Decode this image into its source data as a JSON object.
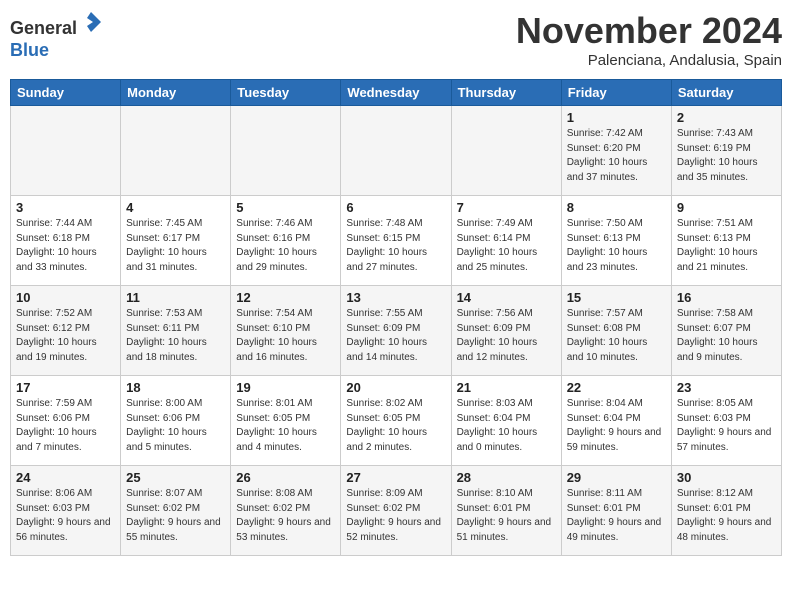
{
  "header": {
    "logo_line1": "General",
    "logo_line2": "Blue",
    "month": "November 2024",
    "location": "Palenciana, Andalusia, Spain"
  },
  "weekdays": [
    "Sunday",
    "Monday",
    "Tuesday",
    "Wednesday",
    "Thursday",
    "Friday",
    "Saturday"
  ],
  "weeks": [
    [
      {
        "day": "",
        "info": ""
      },
      {
        "day": "",
        "info": ""
      },
      {
        "day": "",
        "info": ""
      },
      {
        "day": "",
        "info": ""
      },
      {
        "day": "",
        "info": ""
      },
      {
        "day": "1",
        "info": "Sunrise: 7:42 AM\nSunset: 6:20 PM\nDaylight: 10 hours and 37 minutes."
      },
      {
        "day": "2",
        "info": "Sunrise: 7:43 AM\nSunset: 6:19 PM\nDaylight: 10 hours and 35 minutes."
      }
    ],
    [
      {
        "day": "3",
        "info": "Sunrise: 7:44 AM\nSunset: 6:18 PM\nDaylight: 10 hours and 33 minutes."
      },
      {
        "day": "4",
        "info": "Sunrise: 7:45 AM\nSunset: 6:17 PM\nDaylight: 10 hours and 31 minutes."
      },
      {
        "day": "5",
        "info": "Sunrise: 7:46 AM\nSunset: 6:16 PM\nDaylight: 10 hours and 29 minutes."
      },
      {
        "day": "6",
        "info": "Sunrise: 7:48 AM\nSunset: 6:15 PM\nDaylight: 10 hours and 27 minutes."
      },
      {
        "day": "7",
        "info": "Sunrise: 7:49 AM\nSunset: 6:14 PM\nDaylight: 10 hours and 25 minutes."
      },
      {
        "day": "8",
        "info": "Sunrise: 7:50 AM\nSunset: 6:13 PM\nDaylight: 10 hours and 23 minutes."
      },
      {
        "day": "9",
        "info": "Sunrise: 7:51 AM\nSunset: 6:13 PM\nDaylight: 10 hours and 21 minutes."
      }
    ],
    [
      {
        "day": "10",
        "info": "Sunrise: 7:52 AM\nSunset: 6:12 PM\nDaylight: 10 hours and 19 minutes."
      },
      {
        "day": "11",
        "info": "Sunrise: 7:53 AM\nSunset: 6:11 PM\nDaylight: 10 hours and 18 minutes."
      },
      {
        "day": "12",
        "info": "Sunrise: 7:54 AM\nSunset: 6:10 PM\nDaylight: 10 hours and 16 minutes."
      },
      {
        "day": "13",
        "info": "Sunrise: 7:55 AM\nSunset: 6:09 PM\nDaylight: 10 hours and 14 minutes."
      },
      {
        "day": "14",
        "info": "Sunrise: 7:56 AM\nSunset: 6:09 PM\nDaylight: 10 hours and 12 minutes."
      },
      {
        "day": "15",
        "info": "Sunrise: 7:57 AM\nSunset: 6:08 PM\nDaylight: 10 hours and 10 minutes."
      },
      {
        "day": "16",
        "info": "Sunrise: 7:58 AM\nSunset: 6:07 PM\nDaylight: 10 hours and 9 minutes."
      }
    ],
    [
      {
        "day": "17",
        "info": "Sunrise: 7:59 AM\nSunset: 6:06 PM\nDaylight: 10 hours and 7 minutes."
      },
      {
        "day": "18",
        "info": "Sunrise: 8:00 AM\nSunset: 6:06 PM\nDaylight: 10 hours and 5 minutes."
      },
      {
        "day": "19",
        "info": "Sunrise: 8:01 AM\nSunset: 6:05 PM\nDaylight: 10 hours and 4 minutes."
      },
      {
        "day": "20",
        "info": "Sunrise: 8:02 AM\nSunset: 6:05 PM\nDaylight: 10 hours and 2 minutes."
      },
      {
        "day": "21",
        "info": "Sunrise: 8:03 AM\nSunset: 6:04 PM\nDaylight: 10 hours and 0 minutes."
      },
      {
        "day": "22",
        "info": "Sunrise: 8:04 AM\nSunset: 6:04 PM\nDaylight: 9 hours and 59 minutes."
      },
      {
        "day": "23",
        "info": "Sunrise: 8:05 AM\nSunset: 6:03 PM\nDaylight: 9 hours and 57 minutes."
      }
    ],
    [
      {
        "day": "24",
        "info": "Sunrise: 8:06 AM\nSunset: 6:03 PM\nDaylight: 9 hours and 56 minutes."
      },
      {
        "day": "25",
        "info": "Sunrise: 8:07 AM\nSunset: 6:02 PM\nDaylight: 9 hours and 55 minutes."
      },
      {
        "day": "26",
        "info": "Sunrise: 8:08 AM\nSunset: 6:02 PM\nDaylight: 9 hours and 53 minutes."
      },
      {
        "day": "27",
        "info": "Sunrise: 8:09 AM\nSunset: 6:02 PM\nDaylight: 9 hours and 52 minutes."
      },
      {
        "day": "28",
        "info": "Sunrise: 8:10 AM\nSunset: 6:01 PM\nDaylight: 9 hours and 51 minutes."
      },
      {
        "day": "29",
        "info": "Sunrise: 8:11 AM\nSunset: 6:01 PM\nDaylight: 9 hours and 49 minutes."
      },
      {
        "day": "30",
        "info": "Sunrise: 8:12 AM\nSunset: 6:01 PM\nDaylight: 9 hours and 48 minutes."
      }
    ]
  ]
}
